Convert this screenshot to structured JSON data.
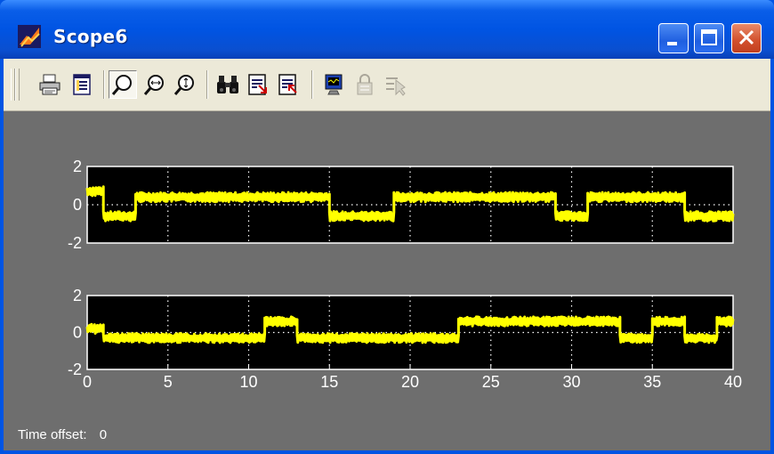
{
  "window": {
    "title": "Scope6"
  },
  "toolbar": {
    "buttons": [
      {
        "id": "print",
        "icon": "printer-icon",
        "enabled": true
      },
      {
        "id": "parameters",
        "icon": "parameters-icon",
        "enabled": true
      },
      {
        "id": "zoom",
        "icon": "zoom-icon",
        "enabled": true,
        "pressed": true
      },
      {
        "id": "zoom-x",
        "icon": "zoom-x-axis-icon",
        "enabled": true
      },
      {
        "id": "zoom-y",
        "icon": "zoom-y-axis-icon",
        "enabled": true
      },
      {
        "id": "autoscale",
        "icon": "binoculars-icon",
        "enabled": true
      },
      {
        "id": "save-axes",
        "icon": "save-axes-icon",
        "enabled": true
      },
      {
        "id": "restore-axes",
        "icon": "restore-axes-icon",
        "enabled": true
      },
      {
        "id": "floating-scope",
        "icon": "floating-scope-icon",
        "enabled": true
      },
      {
        "id": "lock-axes",
        "icon": "lock-icon",
        "enabled": false
      },
      {
        "id": "signal-selection",
        "icon": "signal-selection-icon",
        "enabled": false
      }
    ]
  },
  "status": {
    "label": "Time offset:",
    "value": "0"
  },
  "colors": {
    "plot_bg": "#000000",
    "figure_bg": "#6e6e6e",
    "trace": "#ffff00",
    "axes": "#ffffff",
    "title_bar": "#0054e3"
  },
  "chart_data": [
    {
      "type": "line",
      "xlim": [
        0,
        40
      ],
      "ylim": [
        -2,
        2
      ],
      "yticks": [
        "2",
        "0",
        "-2"
      ],
      "xticks": [],
      "grid": true,
      "noise_amplitude": 0.25,
      "segments": [
        {
          "from": 0,
          "to": 1,
          "level": 0.7
        },
        {
          "from": 1,
          "to": 3,
          "level": -0.6
        },
        {
          "from": 3,
          "to": 15,
          "level": 0.4
        },
        {
          "from": 15,
          "to": 19,
          "level": -0.6
        },
        {
          "from": 19,
          "to": 29,
          "level": 0.4
        },
        {
          "from": 29,
          "to": 31,
          "level": -0.6
        },
        {
          "from": 31,
          "to": 37,
          "level": 0.4
        },
        {
          "from": 37,
          "to": 40,
          "level": -0.6
        }
      ]
    },
    {
      "type": "line",
      "xlim": [
        0,
        40
      ],
      "ylim": [
        -2,
        2
      ],
      "yticks": [
        "2",
        "0",
        "-2"
      ],
      "xticks": [
        "0",
        "5",
        "10",
        "15",
        "20",
        "25",
        "30",
        "35",
        "40"
      ],
      "grid": true,
      "noise_amplitude": 0.25,
      "segments": [
        {
          "from": 0,
          "to": 1,
          "level": 0.2
        },
        {
          "from": 1,
          "to": 11,
          "level": -0.3
        },
        {
          "from": 11,
          "to": 13,
          "level": 0.6
        },
        {
          "from": 13,
          "to": 23,
          "level": -0.3
        },
        {
          "from": 23,
          "to": 33,
          "level": 0.6
        },
        {
          "from": 33,
          "to": 35,
          "level": -0.3
        },
        {
          "from": 35,
          "to": 37,
          "level": 0.6
        },
        {
          "from": 37,
          "to": 39,
          "level": -0.3
        },
        {
          "from": 39,
          "to": 40,
          "level": 0.6
        }
      ]
    }
  ]
}
